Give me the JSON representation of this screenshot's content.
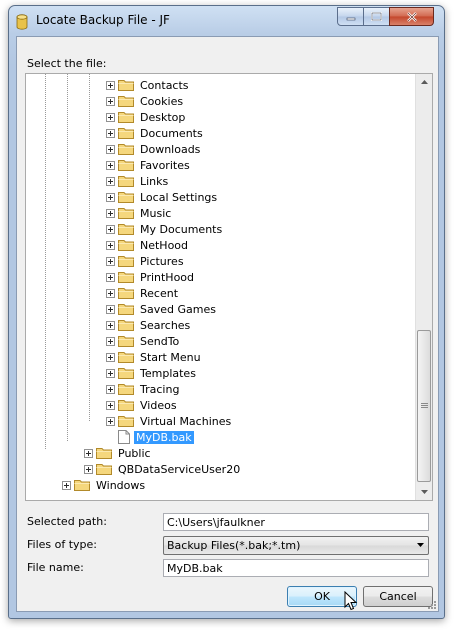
{
  "window": {
    "title": "Locate Backup File - JF"
  },
  "tree": {
    "label": "Select the file:",
    "items": [
      {
        "label": "Contacts"
      },
      {
        "label": "Cookies"
      },
      {
        "label": "Desktop"
      },
      {
        "label": "Documents"
      },
      {
        "label": "Downloads"
      },
      {
        "label": "Favorites"
      },
      {
        "label": "Links"
      },
      {
        "label": "Local Settings"
      },
      {
        "label": "Music"
      },
      {
        "label": "My Documents"
      },
      {
        "label": "NetHood"
      },
      {
        "label": "Pictures"
      },
      {
        "label": "PrintHood"
      },
      {
        "label": "Recent"
      },
      {
        "label": "Saved Games"
      },
      {
        "label": "Searches"
      },
      {
        "label": "SendTo"
      },
      {
        "label": "Start Menu"
      },
      {
        "label": "Templates"
      },
      {
        "label": "Tracing"
      },
      {
        "label": "Videos"
      },
      {
        "label": "Virtual Machines"
      }
    ],
    "selected_file": "MyDB.bak",
    "siblings": [
      {
        "label": "Public"
      },
      {
        "label": "QBDataServiceUser20"
      }
    ],
    "root_sibling": "Windows"
  },
  "form": {
    "selected_path_label": "Selected path:",
    "selected_path_value": "C:\\Users\\jfaulkner",
    "files_of_type_label": "Files of type:",
    "files_of_type_value": "Backup Files(*.bak;*.tm)",
    "file_name_label": "File name:",
    "file_name_value": "MyDB.bak"
  },
  "buttons": {
    "ok": "OK",
    "cancel": "Cancel"
  },
  "colors": {
    "selection": "#3399ff",
    "title_bar": "#b9cde6",
    "close_button": "#c4462b"
  }
}
